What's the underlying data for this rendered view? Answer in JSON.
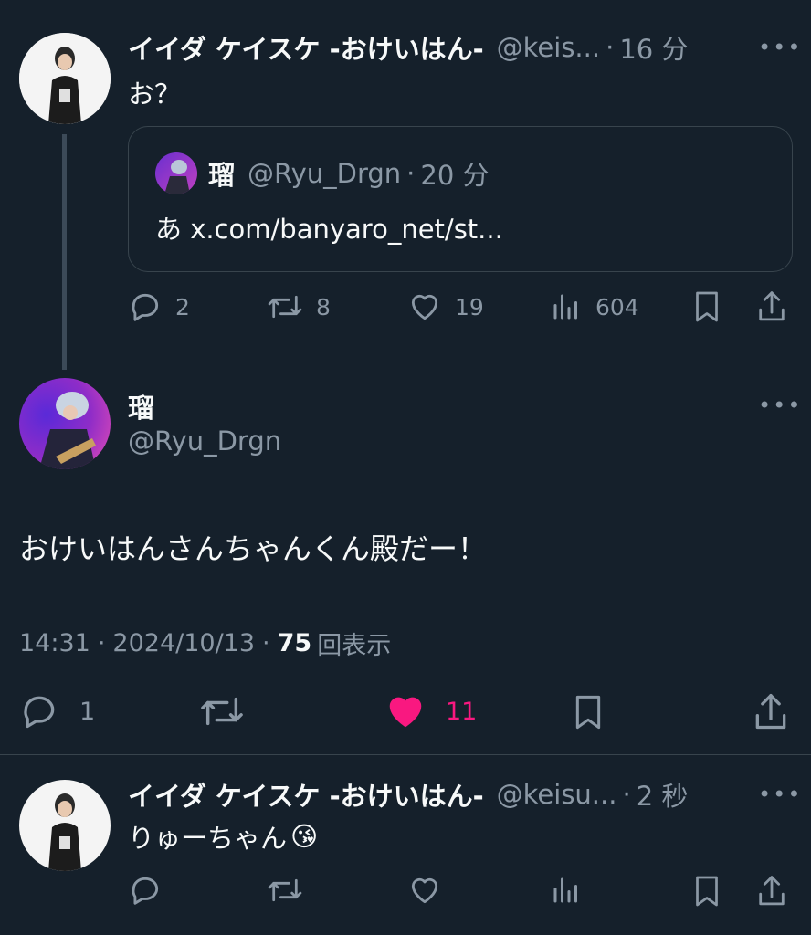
{
  "tweet1": {
    "display_name": "イイダ ケイスケ -おけいはん-",
    "handle": "@keis...",
    "time": "16 分",
    "text": "お？",
    "quote": {
      "display_name": "瑠",
      "handle": "@Ryu_Drgn",
      "time": "20 分",
      "text": "あ x.com/banyaro_net/st..."
    },
    "actions": {
      "replies": "2",
      "reposts": "8",
      "likes": "19",
      "views": "604"
    }
  },
  "main_tweet": {
    "display_name": "瑠",
    "handle": "@Ryu_Drgn",
    "text": "おけいはんさんちゃんくん殿だー！",
    "time": "14:31",
    "date": "2024/10/13",
    "views_count": "75",
    "views_label": "回表示",
    "actions": {
      "replies": "1",
      "likes": "11"
    }
  },
  "reply_tweet": {
    "display_name": "イイダ ケイスケ -おけいはん-",
    "handle": "@keisu...",
    "time": "2 秒",
    "text": "りゅーちゃん",
    "emoji": "😘"
  },
  "colors": {
    "background": "#15202b",
    "text": "#f7f9f9",
    "muted": "#8b98a5",
    "like": "#f91880",
    "border": "#38444d"
  },
  "icons": [
    "more-icon",
    "reply-icon",
    "repost-icon",
    "like-icon",
    "views-icon",
    "bookmark-icon",
    "share-icon"
  ]
}
